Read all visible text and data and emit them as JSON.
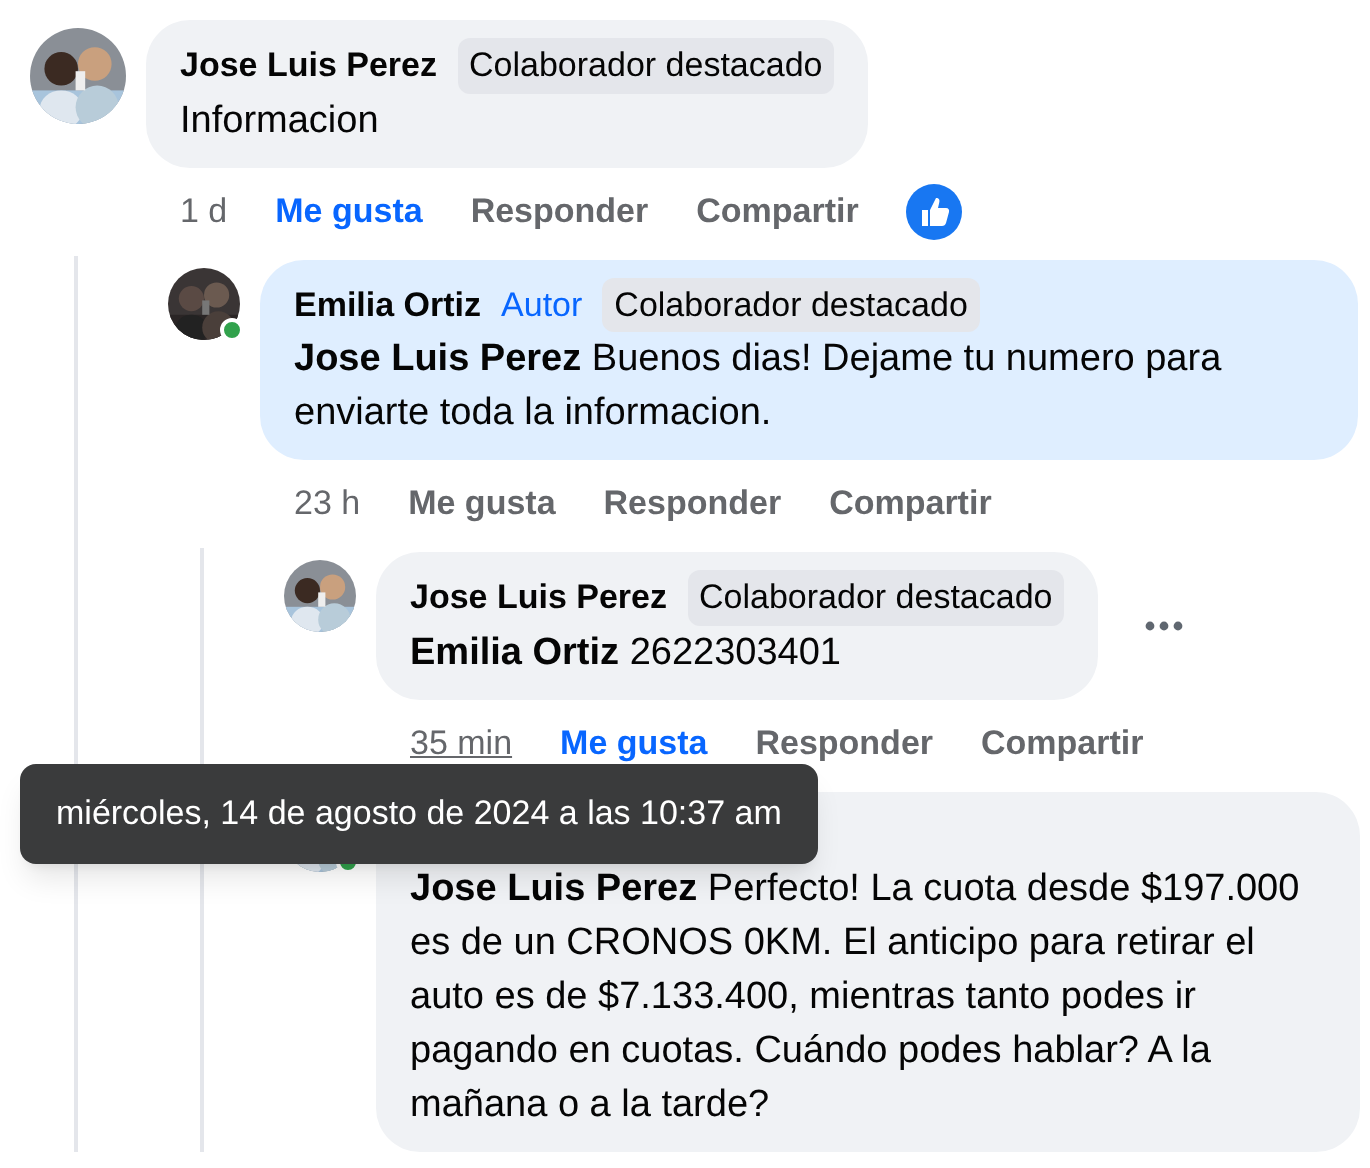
{
  "comments": [
    {
      "author": "Jose Luis Perez",
      "badges": [
        {
          "kind": "featured",
          "label": "Colaborador destacado"
        }
      ],
      "body": "Informacion",
      "time": "1 d",
      "actions": [
        {
          "label": "Me gusta",
          "selected": true
        },
        {
          "label": "Responder",
          "selected": false
        },
        {
          "label": "Compartir",
          "selected": false
        }
      ],
      "like_reaction_shown": true,
      "children": [
        {
          "author": "Emilia Ortiz",
          "badges": [
            {
              "kind": "author",
              "label": "Autor"
            },
            {
              "kind": "featured",
              "label": "Colaborador destacado"
            }
          ],
          "mention": "Jose Luis Perez",
          "body": "Buenos dias! Dejame tu numero para enviarte toda la informacion.",
          "highlighted": true,
          "online": true,
          "time": "23 h",
          "actions": [
            {
              "label": "Me gusta",
              "selected": false
            },
            {
              "label": "Responder",
              "selected": false
            },
            {
              "label": "Compartir",
              "selected": false
            }
          ],
          "children": [
            {
              "author": "Jose Luis Perez",
              "badges": [
                {
                  "kind": "featured",
                  "label": "Colaborador destacado"
                }
              ],
              "mention": "Emilia Ortiz",
              "body": "2622303401",
              "time": "35 min",
              "time_hovered": true,
              "actions": [
                {
                  "label": "Me gusta",
                  "selected": true
                },
                {
                  "label": "Responder",
                  "selected": false
                },
                {
                  "label": "Compartir",
                  "selected": false
                }
              ],
              "more_button": true
            },
            {
              "mention": "Jose Luis Perez",
              "body": "Perfecto! La cuota desde $197.000 es de un CRONOS 0KM. El anticipo para retirar el auto es de $7.133.400, mientras tanto podes ir pagando en cuotas. Cuándo podes hablar? A la mañana o a la tarde?",
              "online": true
            }
          ]
        }
      ]
    }
  ],
  "tooltip": {
    "text": "miércoles, 14 de agosto de 2024 a las 10:37 am"
  }
}
